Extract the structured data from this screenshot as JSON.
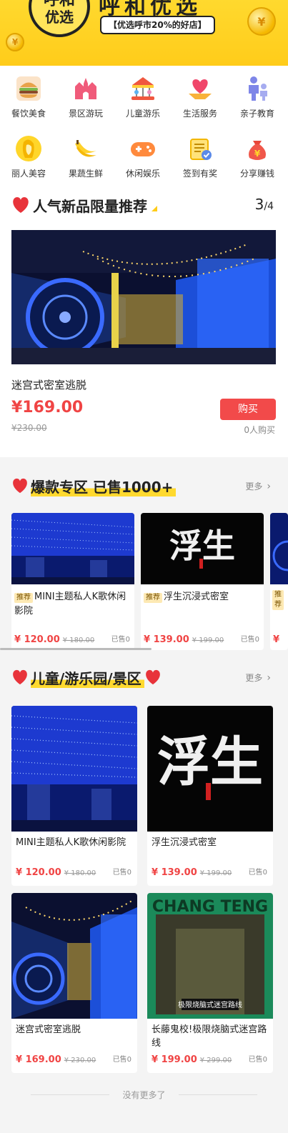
{
  "banner": {
    "logo_top": "呼和",
    "logo_bottom": "优选",
    "title": "呼和优选",
    "slogan": "【优选呼市20%的好店】",
    "coin_symbol": "¥"
  },
  "categories": [
    {
      "label": "餐饮美食",
      "icon": "burger-icon"
    },
    {
      "label": "景区游玩",
      "icon": "castle-icon"
    },
    {
      "label": "儿童游乐",
      "icon": "carousel-icon"
    },
    {
      "label": "生活服务",
      "icon": "heart-hands-icon"
    },
    {
      "label": "亲子教育",
      "icon": "family-icon"
    },
    {
      "label": "丽人美容",
      "icon": "woman-icon"
    },
    {
      "label": "果蔬生鲜",
      "icon": "banana-icon"
    },
    {
      "label": "休闲娱乐",
      "icon": "gamepad-icon"
    },
    {
      "label": "签到有奖",
      "icon": "checkin-icon"
    },
    {
      "label": "分享赚钱",
      "icon": "money-bag-icon"
    }
  ],
  "hot_new": {
    "title": "人气新品限量推荐",
    "page_current": "3",
    "page_total": "/4",
    "product_name": "迷宫式密室逃脱",
    "price": "¥169.00",
    "old_price": "¥230.00",
    "buy_label": "购买",
    "sold": "0人购买"
  },
  "baokuan": {
    "title": "爆款专区 已售1000+",
    "more": "更多",
    "items": [
      {
        "tag": "推荐",
        "title": "MINI主题私人K歌休闲影院",
        "price": "¥ 120.00",
        "old": "¥ 180.00",
        "sold": "已售0"
      },
      {
        "tag": "推荐",
        "title": "浮生沉浸式密室",
        "price": "¥ 139.00",
        "old": "¥ 199.00",
        "sold": "已售0"
      },
      {
        "tag": "推荐",
        "title": "",
        "price": "¥",
        "old": "",
        "sold": ""
      }
    ]
  },
  "kids": {
    "title": "儿童/游乐园/景区",
    "more": "更多",
    "items": [
      {
        "title": "MINI主题私人K歌休闲影院",
        "price": "¥ 120.00",
        "old": "¥ 180.00",
        "sold": "已售0"
      },
      {
        "title": "浮生沉浸式密室",
        "price": "¥ 139.00",
        "old": "¥ 199.00",
        "sold": "已售0"
      },
      {
        "title": "迷宫式密室逃脱",
        "price": "¥ 169.00",
        "old": "¥ 230.00",
        "sold": "已售0"
      },
      {
        "title": "长藤鬼校!极限烧脑式迷宫路线",
        "price": "¥ 199.00",
        "old": "¥ 299.00",
        "sold": "已售0"
      }
    ]
  },
  "footer": {
    "no_more": "没有更多了"
  },
  "art": {
    "fusheng_text": "浮生",
    "chang_teng_text": "CHANG TENG",
    "chang_teng_banner": "极限烧脑式迷宫路线"
  },
  "colors": {
    "brand_yellow": "#ffd92e",
    "price_red": "#f04444",
    "buy_red": "#f24a4a"
  }
}
